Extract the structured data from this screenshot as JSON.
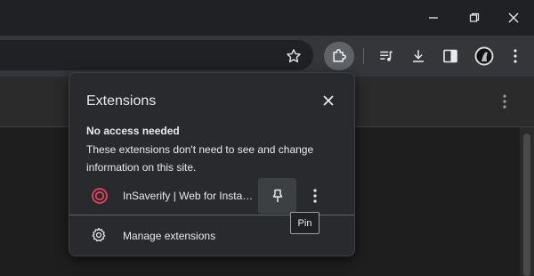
{
  "window": {
    "controls": [
      "minimize-icon",
      "restore-icon",
      "close-icon"
    ]
  },
  "toolbar": {
    "icons": [
      "star-icon",
      "extensions-puzzle-icon",
      "reading-list-icon",
      "download-icon",
      "side-panel-icon",
      "profile-avatar",
      "kebab-menu-icon"
    ]
  },
  "extensions_popup": {
    "title": "Extensions",
    "section_heading": "No access needed",
    "section_description": "These extensions don't need to see and change information on this site.",
    "extension": {
      "name": "InSaverify | Web for Instagram",
      "icon_color": "#e94160"
    },
    "manage_label": "Manage extensions",
    "tooltip": "Pin"
  },
  "colors": {
    "background": "#202124",
    "toolbar": "#35363a",
    "popup": "#292a2d",
    "active_button": "#5f6368",
    "text": "#e8eaed"
  }
}
